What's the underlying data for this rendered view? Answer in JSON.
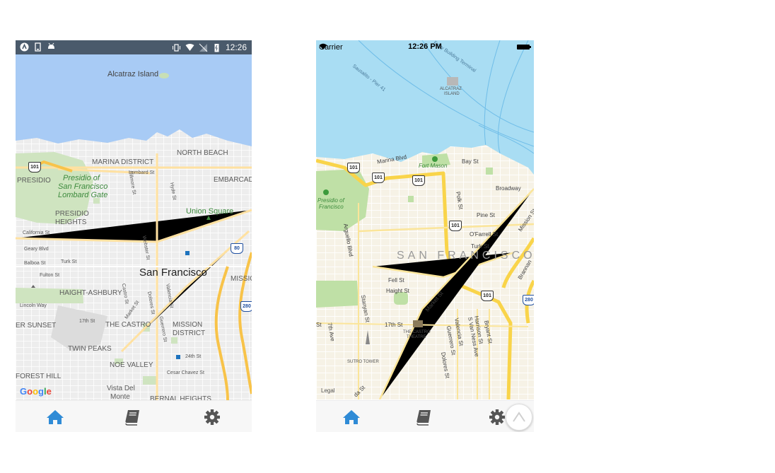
{
  "android": {
    "status_time": "12:26",
    "logo": "Google",
    "labels": {
      "alcatraz": "Alcatraz Island",
      "north_beach": "NORTH BEACH",
      "marina": "MARINA DISTRICT",
      "presidio_sf_1": "Presidio of",
      "presidio_sf_2": "San Francisco",
      "presidio_sf_3": "Lombard Gate",
      "presidio": "PRESIDIO",
      "embarcadero": "EMBARCADE",
      "union_square": "Union Square",
      "presidio_heights_1": "PRESIDIO",
      "presidio_heights_2": "HEIGHTS",
      "san_francisco": "San Francisco",
      "haight": "HAIGHT-ASHBURY",
      "missio": "MISSIO",
      "sunset": "ER SUNSET",
      "castro": "THE CASTRO",
      "mission_1": "MISSION",
      "mission_2": "DISTRICT",
      "twin_peaks": "TWIN PEAKS",
      "noe_valley": "NOE VALLEY",
      "forest_hill": "FOREST HILL",
      "vista_1": "Vista Del",
      "vista_2": "Monte",
      "bernal": "BERNAL HEIGHTS",
      "lombard_st": "Lombard St",
      "california_st": "California St",
      "geary_blvd": "Geary Blvd",
      "balboa_st": "Balboa St",
      "fulton_st": "Fulton St",
      "lincoln_way": "Lincoln Way",
      "turk_st": "Turk St",
      "st17": "17th St",
      "st24": "24th St",
      "cesar_chavez": "Cesar Chavez St",
      "fillmore_st": "Fillmore St",
      "hyde_st": "Hyde St",
      "webster_st": "Webster St",
      "guerrero_st": "Guerrero St",
      "valencia_st": "Valencia St",
      "dolores_st": "Dolores St",
      "castro_st": "Castro St",
      "market_st": "Market St"
    },
    "shields": {
      "s101": "101",
      "s80": "80",
      "s280": "280"
    }
  },
  "ios": {
    "carrier": "Carrier",
    "status_time": "12:26 PM",
    "legal": "Legal",
    "labels": {
      "sausalito": "Sausalito - Pier 41",
      "ferry": "Ferry Building Terminal",
      "alcatraz_1": "ALCATRAZ",
      "alcatraz_2": "ISLAND",
      "marina_blvd": "Marina Blvd",
      "fort_mason": "Fort Mason",
      "bay_st": "Bay St",
      "broadway": "Broadway",
      "presidio_1": "Presidio of",
      "presidio_2": "Francisco",
      "polk_st": "Polk St",
      "pine_st": "Pine St",
      "ofarrell_st": "O'Farrell St",
      "turk_st": "Turk St",
      "mission_st": "Mission St",
      "san_francisco": "SAN FRANCISCO",
      "arguello": "Arguello Blvd",
      "fell_st": "Fell St",
      "haight_st": "Haight St",
      "market_st": "Market St",
      "brannan": "Brannan",
      "stanyan": "Stanyan St",
      "st17": "17th St",
      "castro_1": "THE CASTRO",
      "castro_2": "THEATRE",
      "ave7": "7th Ave",
      "st_st": "St",
      "guerrero": "Guerrero St",
      "valencia": "Valencia St",
      "south_van_ness": "S Van Ness Ave",
      "harrison": "Harrison St",
      "bryant": "Bryant St",
      "dolores": "Dolores St",
      "sutro": "SUTRO TOWER",
      "da_st": "da St"
    },
    "shields": {
      "s101": "101",
      "s280": "280"
    }
  },
  "tabs": [
    {
      "name": "home",
      "icon": "home-icon",
      "active": true
    },
    {
      "name": "library",
      "icon": "book-icon",
      "active": false
    },
    {
      "name": "settings",
      "icon": "gear-icon",
      "active": false
    }
  ],
  "colors": {
    "accent": "#2f8bd6",
    "tab_inactive": "#555555",
    "google_water": "#a8cbf5",
    "apple_water": "#a9ddf3",
    "apple_land": "#f6f2e6",
    "highway": "#f9d44a"
  }
}
